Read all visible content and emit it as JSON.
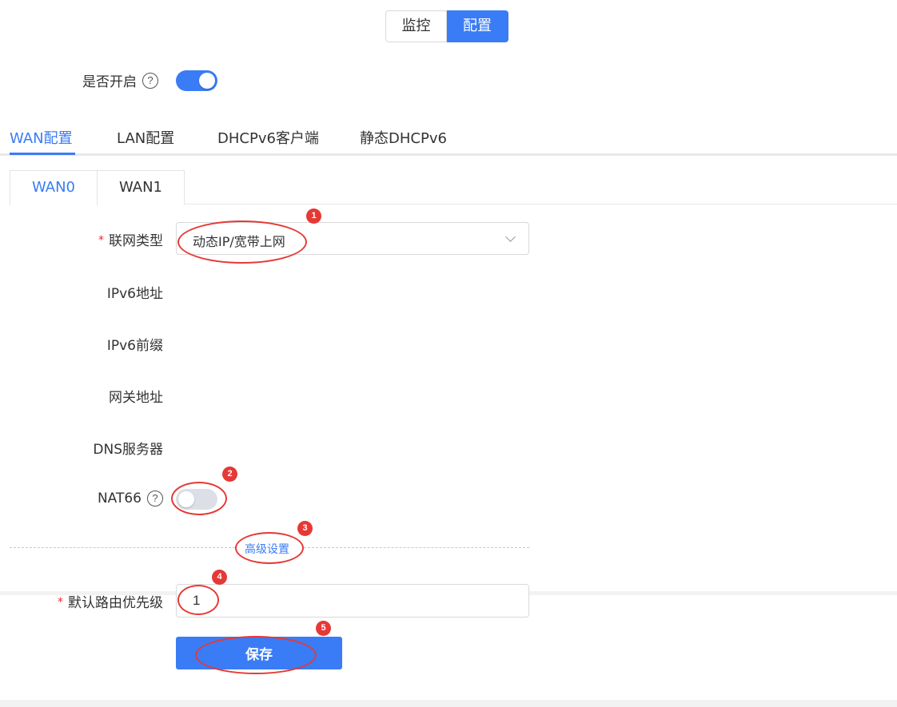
{
  "top_switch": {
    "monitor": "监控",
    "config": "配置"
  },
  "enable": {
    "label": "是否开启",
    "help": "?",
    "on": true
  },
  "tabs": [
    {
      "label": "WAN配置"
    },
    {
      "label": "LAN配置"
    },
    {
      "label": "DHCPv6客户端"
    },
    {
      "label": "静态DHCPv6"
    }
  ],
  "subtabs": [
    {
      "label": "WAN0"
    },
    {
      "label": "WAN1"
    }
  ],
  "form": {
    "required_mark": "*",
    "conn_type_label": "联网类型",
    "conn_type_value": "动态IP/宽带上网",
    "ipv6_addr_label": "IPv6地址",
    "ipv6_prefix_label": "IPv6前缀",
    "gateway_label": "网关地址",
    "dns_label": "DNS服务器",
    "nat66_label": "NAT66",
    "nat66_help": "?",
    "nat66_on": false,
    "advanced_label": "高级设置",
    "route_priority_label": "默认路由优先级",
    "route_priority_value": "1",
    "save_label": "保存"
  },
  "annotations": [
    "1",
    "2",
    "3",
    "4",
    "5"
  ],
  "colors": {
    "accent": "#3a7cf5",
    "annotation": "#e53935",
    "required": "#f5222d"
  }
}
